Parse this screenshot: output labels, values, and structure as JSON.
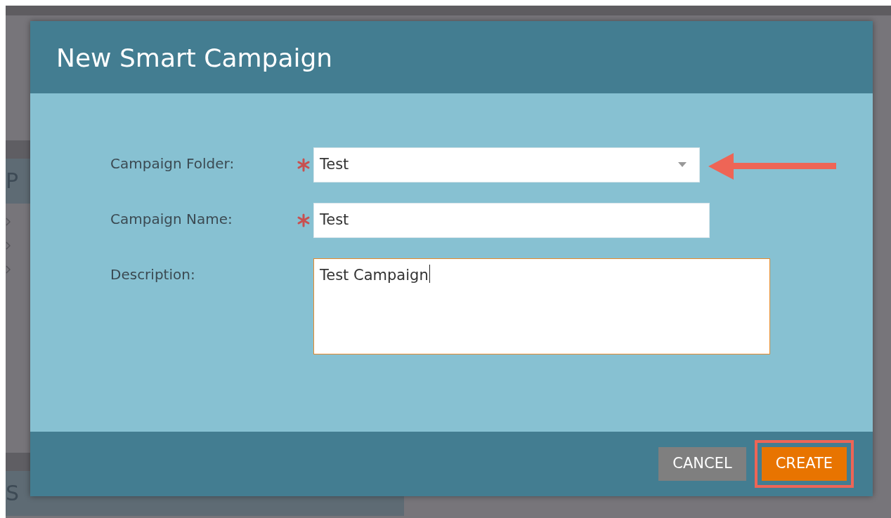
{
  "background": {
    "sections": [
      {
        "heading": "P"
      },
      {
        "heading": "S"
      }
    ]
  },
  "dialog": {
    "title": "New Smart Campaign",
    "fields": [
      {
        "kind": "select",
        "label": "Campaign Folder:",
        "required": true,
        "value": "Test",
        "annotated": true
      },
      {
        "kind": "text",
        "label": "Campaign Name:",
        "required": true,
        "value": "Test",
        "annotated": false
      },
      {
        "kind": "textarea",
        "label": "Description:",
        "required": false,
        "value": "Test Campaign",
        "focused": true,
        "annotated": false
      }
    ],
    "buttons": [
      {
        "label": "CANCEL",
        "kind": "secondary",
        "highlighted": false
      },
      {
        "label": "CREATE",
        "kind": "primary",
        "highlighted": true
      }
    ]
  }
}
